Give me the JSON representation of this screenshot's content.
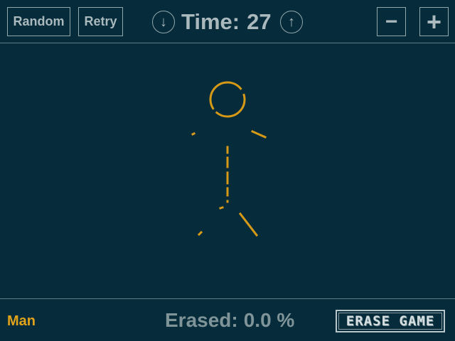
{
  "toolbar": {
    "random_label": "Random",
    "retry_label": "Retry",
    "time_down_icon": "↓",
    "time_up_icon": "↑",
    "time_label": "Time:",
    "time_value": "27",
    "minus_label": "−",
    "plus_label": "+"
  },
  "stage": {
    "shape_color": "#d69a17",
    "icon": "stick-figure-icon"
  },
  "status": {
    "shape_name": "Man",
    "erased_label": "Erased:",
    "erased_value": "0.0 %",
    "logo_text": "ERASE GAME"
  },
  "colors": {
    "background": "#062b3a",
    "text": "#a9b9bd",
    "accent": "#e1a31a",
    "border": "#91a7ac"
  }
}
